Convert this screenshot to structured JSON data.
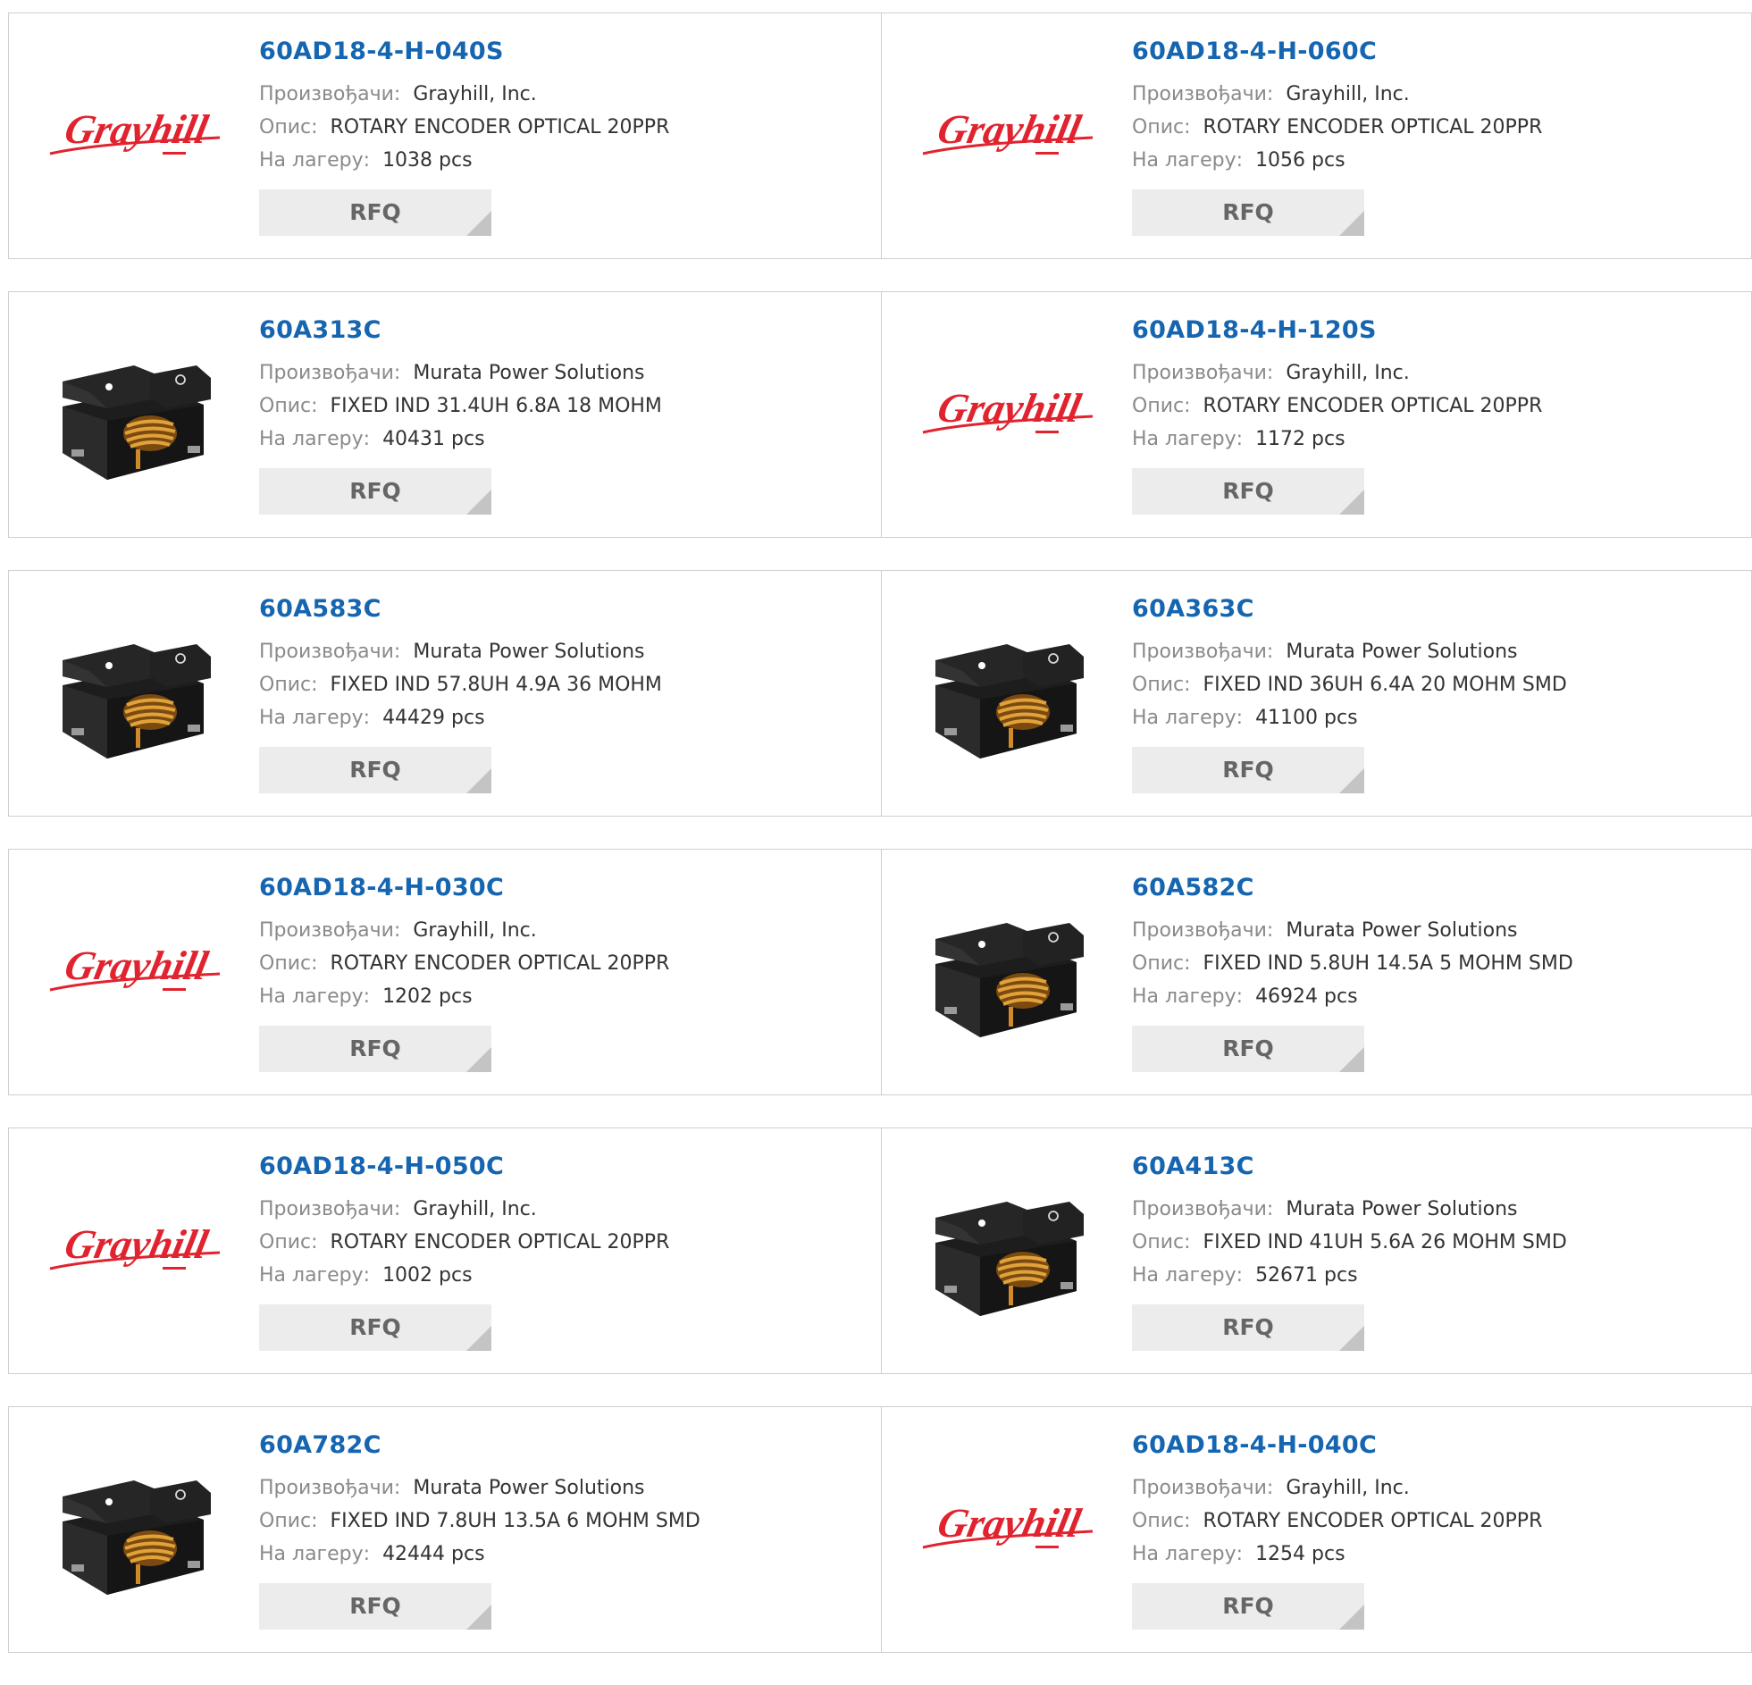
{
  "labels": {
    "manufacturer": "Произвођачи:",
    "description": "Опис:",
    "stock": "На лагеру:",
    "rfq": "RFQ"
  },
  "colors": {
    "part_link": "#1565b0",
    "brand_red": "#e0232e",
    "button_bg": "#ececec"
  },
  "products": [
    {
      "part": "60AD18-4-H-040S",
      "manufacturer": "Grayhill, Inc.",
      "description": "ROTARY ENCODER OPTICAL 20PPR",
      "stock": "1038 pcs",
      "image": "grayhill-logo"
    },
    {
      "part": "60AD18-4-H-060C",
      "manufacturer": "Grayhill, Inc.",
      "description": "ROTARY ENCODER OPTICAL 20PPR",
      "stock": "1056 pcs",
      "image": "grayhill-logo"
    },
    {
      "part": "60A313C",
      "manufacturer": "Murata Power Solutions",
      "description": "FIXED IND 31.4UH 6.8A 18 MOHM",
      "stock": "40431 pcs",
      "image": "inductor-photo"
    },
    {
      "part": "60AD18-4-H-120S",
      "manufacturer": "Grayhill, Inc.",
      "description": "ROTARY ENCODER OPTICAL 20PPR",
      "stock": "1172 pcs",
      "image": "grayhill-logo"
    },
    {
      "part": "60A583C",
      "manufacturer": "Murata Power Solutions",
      "description": "FIXED IND 57.8UH 4.9A 36 MOHM",
      "stock": "44429 pcs",
      "image": "inductor-photo"
    },
    {
      "part": "60A363C",
      "manufacturer": "Murata Power Solutions",
      "description": "FIXED IND 36UH 6.4A 20 MOHM SMD",
      "stock": "41100 pcs",
      "image": "inductor-photo"
    },
    {
      "part": "60AD18-4-H-030C",
      "manufacturer": "Grayhill, Inc.",
      "description": "ROTARY ENCODER OPTICAL 20PPR",
      "stock": "1202 pcs",
      "image": "grayhill-logo"
    },
    {
      "part": "60A582C",
      "manufacturer": "Murata Power Solutions",
      "description": "FIXED IND 5.8UH 14.5A 5 MOHM SMD",
      "stock": "46924 pcs",
      "image": "inductor-photo"
    },
    {
      "part": "60AD18-4-H-050C",
      "manufacturer": "Grayhill, Inc.",
      "description": "ROTARY ENCODER OPTICAL 20PPR",
      "stock": "1002 pcs",
      "image": "grayhill-logo"
    },
    {
      "part": "60A413C",
      "manufacturer": "Murata Power Solutions",
      "description": "FIXED IND 41UH 5.6A 26 MOHM SMD",
      "stock": "52671 pcs",
      "image": "inductor-photo"
    },
    {
      "part": "60A782C",
      "manufacturer": "Murata Power Solutions",
      "description": "FIXED IND 7.8UH 13.5A 6 MOHM SMD",
      "stock": "42444 pcs",
      "image": "inductor-photo"
    },
    {
      "part": "60AD18-4-H-040C",
      "manufacturer": "Grayhill, Inc.",
      "description": "ROTARY ENCODER OPTICAL 20PPR",
      "stock": "1254 pcs",
      "image": "grayhill-logo"
    }
  ]
}
